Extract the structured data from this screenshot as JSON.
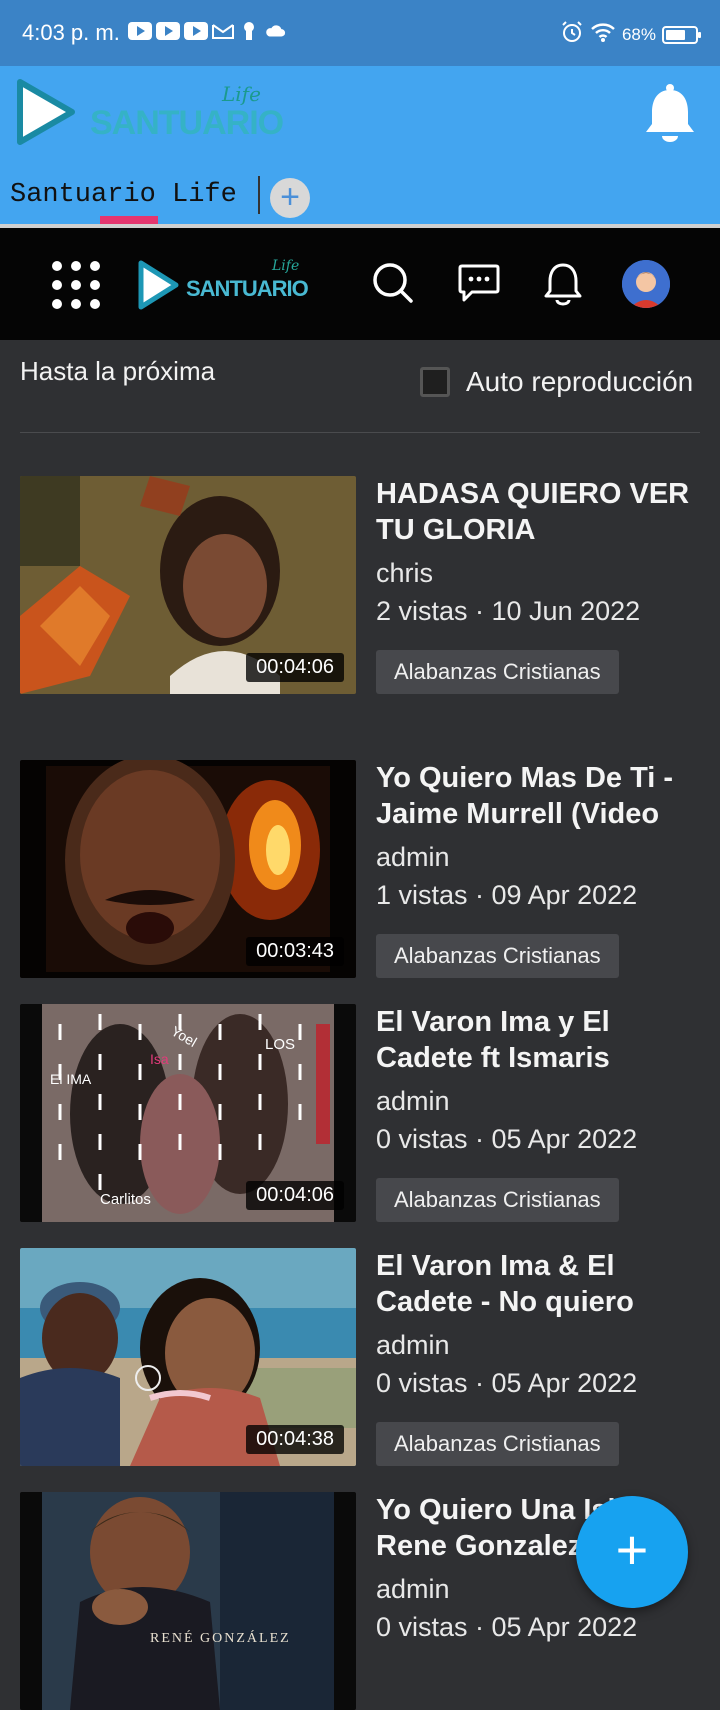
{
  "statusbar": {
    "time": "4:03 p. m.",
    "battery_text": "68%",
    "battery_level": 0.68,
    "icons": [
      "youtube-icon",
      "youtube-icon",
      "youtube-icon",
      "gmail-icon",
      "keyhole-icon",
      "cloud-icon",
      "alarm-icon",
      "wifi-icon",
      "battery-icon"
    ]
  },
  "appbar": {
    "logo_word": "SANTUARIO",
    "logo_script": "Life",
    "tab_label": "Santuario Life",
    "add_tab": "+"
  },
  "sitenav": {
    "logo_word": "SANTUARIO",
    "logo_script": "Life"
  },
  "page": {
    "heading": "Hasta la próxima",
    "autoplay_label": "Auto reproducción",
    "autoplay_checked": false
  },
  "videos": [
    {
      "title": "HADASA QUIERO VER TU GLORIA",
      "author": "chris",
      "meta": "2 vistas · 10 Jun 2022",
      "category": "Alabanzas Cristianas",
      "duration": "00:04:06"
    },
    {
      "title": "Yo Quiero Mas De Ti - Jaime Murrell (Video",
      "author": "admin",
      "meta": "1 vistas · 09 Apr 2022",
      "category": "Alabanzas Cristianas",
      "duration": "00:03:43"
    },
    {
      "title": "El Varon Ima y El Cadete ft Ismaris",
      "author": "admin",
      "meta": "0 vistas · 05 Apr 2022",
      "category": "Alabanzas Cristianas",
      "duration": "00:04:06"
    },
    {
      "title": "El Varon Ima & El Cadete - No quiero",
      "author": "admin",
      "meta": "0 vistas · 05 Apr 2022",
      "category": "Alabanzas Cristianas",
      "duration": "00:04:38"
    },
    {
      "title": "Yo Quiero Una Isla - Rene Gonzalez",
      "author": "admin",
      "meta": "0 vistas · 05 Apr 2022",
      "category": "",
      "duration": ""
    }
  ],
  "thumbnail_text": {
    "v3": [
      "Yoel",
      "Isa",
      "LOS",
      "El IMA",
      "Carlitos"
    ],
    "v5": [
      "RENÉ GONZÁLEZ"
    ]
  },
  "fab": "+",
  "colors": {
    "statusbar": "#3b83c6",
    "appbar": "#43a5f0",
    "tab_underline": "#e5366f",
    "sitenav": "#050505",
    "background": "#2f3033",
    "fab": "#17a2f0"
  }
}
